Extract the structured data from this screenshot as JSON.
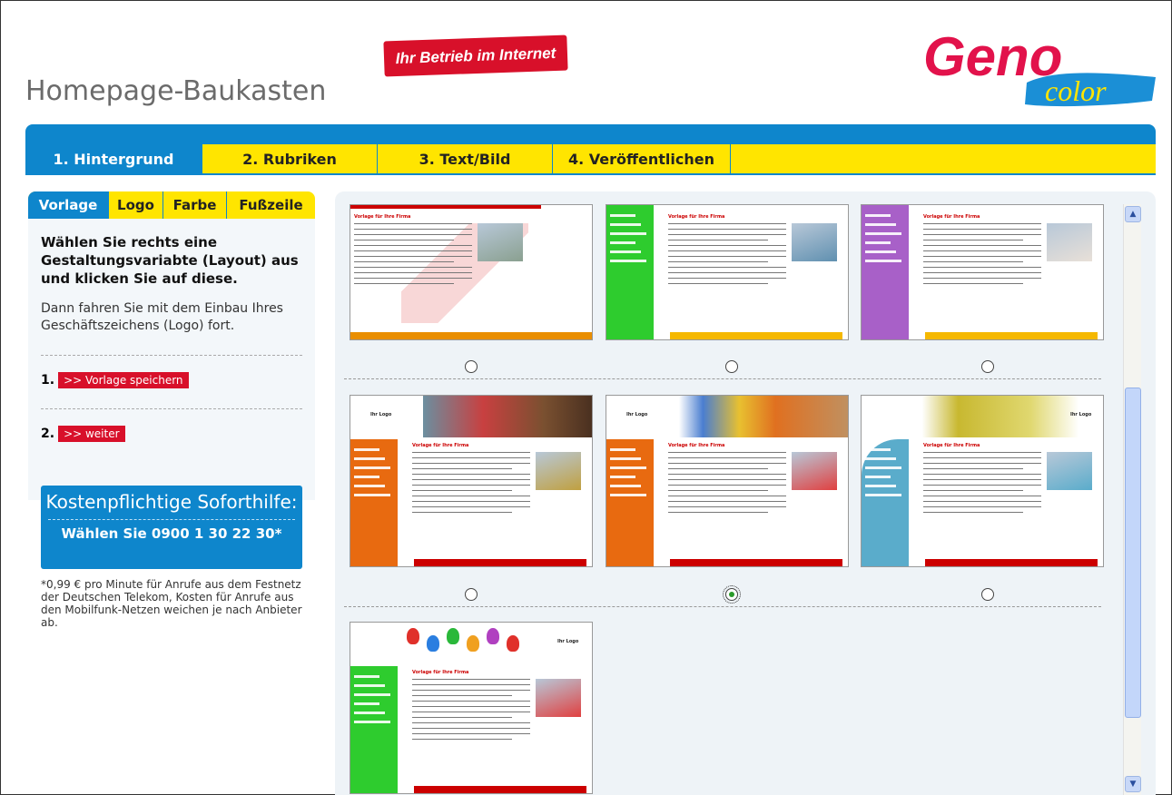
{
  "header": {
    "title": "Homepage-Baukasten",
    "slogan": "Ihr Betrieb im Internet",
    "logo_main": "Geno",
    "logo_sub": "color"
  },
  "main_tabs": [
    {
      "label": "1. Hintergrund",
      "active": true
    },
    {
      "label": "2. Rubriken",
      "active": false
    },
    {
      "label": "3. Text/Bild",
      "active": false
    },
    {
      "label": "4. Veröffentlichen",
      "active": false
    }
  ],
  "sub_tabs": [
    {
      "label": "Vorlage",
      "active": true
    },
    {
      "label": "Logo",
      "active": false
    },
    {
      "label": "Farbe",
      "active": false
    },
    {
      "label": "Fußzeile",
      "active": false
    }
  ],
  "sidebar": {
    "instruction_bold": "Wählen Sie rechts eine Gestaltungsvariabte (Layout) aus und klicken Sie auf diese.",
    "instruction_text": "Dann fahren Sie mit dem Einbau Ihres Geschäftszeichens (Logo) fort.",
    "step1_num": "1.",
    "step1_button": ">> Vorlage speichern",
    "step2_num": "2.",
    "step2_button": ">> weiter"
  },
  "hotline": {
    "title": "Kostenpflichtige Soforthilfe:",
    "number": "Wählen Sie 0900 1 30 22 30*",
    "footnote": "*0,99 € pro Minute für Anrufe aus dem Festnetz der Deutschen Telekom, Kosten für Anrufe aus den Mobilfunk-Netzen weichen je nach Anbieter ab."
  },
  "templates": [
    {
      "name": "template-1",
      "side": "#ffffff",
      "accent": "#e98e00",
      "selected": false,
      "title": "Vorlage für Ihre Firma",
      "logo_text": ""
    },
    {
      "name": "template-2",
      "side": "#2ecc2e",
      "accent": "#f5b800",
      "selected": false,
      "title": "Vorlage für Ihre Firma",
      "logo_text": ""
    },
    {
      "name": "template-3",
      "side": "#a860c8",
      "accent": "#f5b800",
      "selected": false,
      "title": "Vorlage für Ihre Firma",
      "logo_text": ""
    },
    {
      "name": "template-4",
      "side": "#e86a10",
      "accent": "#cc0000",
      "selected": false,
      "title": "Vorlage für Ihre Firma",
      "logo_text": "Ihr Logo"
    },
    {
      "name": "template-5",
      "side": "#e86a10",
      "accent": "#cc0000",
      "selected": true,
      "title": "Vorlage für Ihre Firma",
      "logo_text": "Ihr Logo"
    },
    {
      "name": "template-6",
      "side": "#5aaccb",
      "accent": "#cc0000",
      "selected": false,
      "title": "Vorlage für Ihre Firma",
      "logo_text": "Ihr Logo"
    },
    {
      "name": "template-7",
      "side": "#2ecc2e",
      "accent": "#cc0000",
      "selected": false,
      "title": "Vorlage für Ihre Firma",
      "logo_text": "Ihr Logo"
    }
  ],
  "icons": {
    "scroll_up": "scroll-up-arrow-icon",
    "scroll_down": "scroll-down-arrow-icon"
  },
  "colors": {
    "brand_blue": "#0e86cc",
    "brand_yellow": "#ffe500",
    "brand_red": "#d8102a"
  }
}
